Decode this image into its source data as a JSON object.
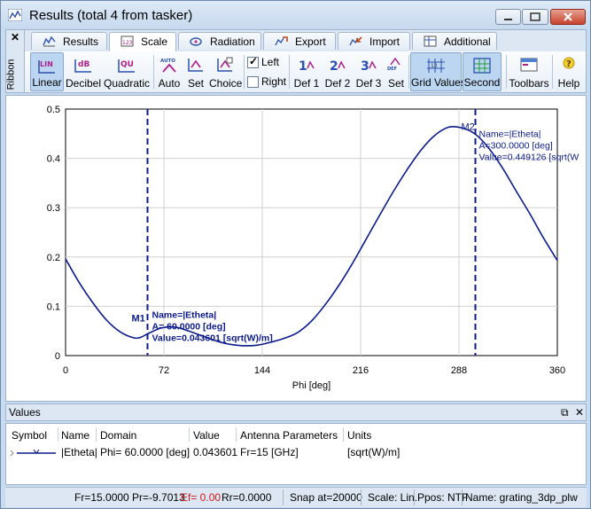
{
  "window": {
    "title": "Results (total 4 from tasker)",
    "min_icon": "minimize-icon",
    "max_icon": "maximize-icon",
    "close_icon": "close-icon"
  },
  "ribbon": {
    "side_close": "✕",
    "side_label": "Ribbon",
    "tabs": [
      {
        "label": "Results",
        "icon": "results-icon",
        "active": false
      },
      {
        "label": "Scale",
        "icon": "scale-icon",
        "active": true
      },
      {
        "label": "Radiation",
        "icon": "radiation-icon",
        "active": false
      },
      {
        "label": "Export",
        "icon": "export-icon",
        "active": false
      },
      {
        "label": "Import",
        "icon": "import-icon",
        "active": false
      },
      {
        "label": "Additional",
        "icon": "additional-icon",
        "active": false
      }
    ],
    "buttons": {
      "linear": {
        "label": "Linear",
        "icon_text": "LIN",
        "pressed": true
      },
      "decibel": {
        "label": "Decibel",
        "icon_text": "dB"
      },
      "quadratic": {
        "label": "Quadratic",
        "icon_text": "QU"
      },
      "auto": {
        "label": "Auto",
        "icon_text": "AUTO"
      },
      "set": {
        "label": "Set"
      },
      "choice": {
        "label": "Choice"
      },
      "left": {
        "label": "Left",
        "checked": true
      },
      "right": {
        "label": "Right",
        "checked": false
      },
      "def1": {
        "label": "Def 1",
        "icon_text": "1"
      },
      "def2": {
        "label": "Def 2",
        "icon_text": "2"
      },
      "def3": {
        "label": "Def 3",
        "icon_text": "3"
      },
      "set2": {
        "label": "Set",
        "icon_text": "DEF"
      },
      "grid_values": {
        "label": "Grid Values",
        "pressed": true
      },
      "second": {
        "label": "Second",
        "pressed": true
      },
      "toolbars": {
        "label": "Toolbars"
      },
      "help": {
        "label": "Help"
      }
    }
  },
  "chart_data": {
    "type": "line",
    "xlabel": "Phi [deg]",
    "ylabel": "",
    "xlim": [
      0,
      360
    ],
    "ylim": [
      0,
      0.5
    ],
    "x_ticks": [
      "0",
      "72",
      "144",
      "216",
      "288",
      "360"
    ],
    "y_ticks": [
      "0",
      "0.1",
      "0.2",
      "0.3",
      "0.4",
      "0.5"
    ],
    "grid": true,
    "series": [
      {
        "color": "#0b1a8c",
        "x": [
          0,
          10,
          20,
          30,
          40,
          50,
          55,
          60,
          70,
          80,
          90,
          100,
          110,
          120,
          130,
          140,
          150,
          160,
          170,
          180,
          190,
          200,
          210,
          220,
          230,
          240,
          250,
          260,
          270,
          280,
          290,
          300,
          310,
          320,
          330,
          340,
          350,
          360
        ],
        "y": [
          0.196,
          0.148,
          0.107,
          0.072,
          0.048,
          0.036,
          0.037,
          0.044,
          0.056,
          0.058,
          0.05,
          0.04,
          0.03,
          0.023,
          0.02,
          0.021,
          0.027,
          0.035,
          0.047,
          0.07,
          0.103,
          0.142,
          0.187,
          0.236,
          0.285,
          0.333,
          0.377,
          0.416,
          0.446,
          0.463,
          0.462,
          0.449,
          0.42,
          0.38,
          0.333,
          0.287,
          0.238,
          0.193
        ]
      }
    ],
    "markers": [
      {
        "label": "M1",
        "x": 60,
        "name_text": "Name=|Etheta|",
        "a_text": "A= 60.0000 [deg]",
        "value_text": "Value=0.043601 [sqrt(W)/m]"
      },
      {
        "label": "M2",
        "x": 300,
        "name_text": "Name=|Etheta|",
        "a_text": "A=300.0000 [deg]",
        "value_text": "Value=0.449126 [sqrt(W"
      }
    ]
  },
  "values_panel": {
    "title": "Values",
    "float_icon": "float-window-icon",
    "close_icon": "close-icon",
    "columns": [
      "Symbol",
      "Name",
      "Domain",
      "Value",
      "Antenna Parameters",
      "Units"
    ],
    "rows": [
      {
        "name": "|Etheta|",
        "domain": "Phi= 60.0000 [deg]",
        "value": "0.043601",
        "params": "Fr=15 [GHz]",
        "units": "[sqrt(W)/m]"
      }
    ]
  },
  "status": {
    "fr_pr": "Fr=15.0000 Pr=-9.7013",
    "ef": "Ef= 0.00",
    "rr": "Rr=0.0000",
    "snap": "Snap at=20000",
    "scale": "Scale: Lin.",
    "ppos": "Ppos: NTF",
    "name": "Name: grating_3dp_plw"
  }
}
